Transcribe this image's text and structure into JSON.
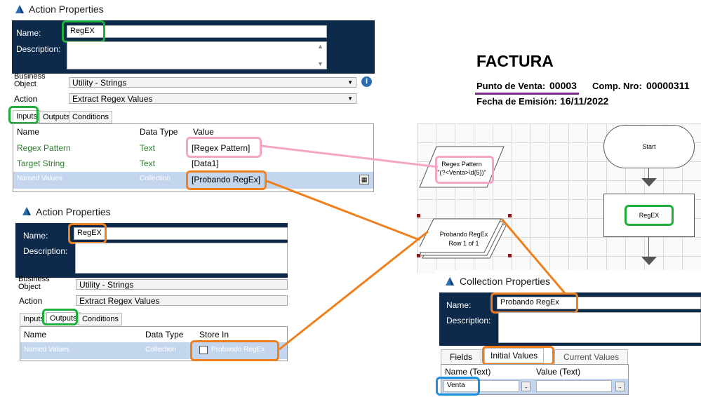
{
  "panel1": {
    "title": "Action Properties",
    "name_label": "Name:",
    "name_value": "RegEX",
    "description_label": "Description:",
    "business_object_label": "Business Object",
    "business_object_value": "Utility - Strings",
    "action_label": "Action",
    "action_value": "Extract Regex Values",
    "tabs": [
      "Inputs",
      "Outputs",
      "Conditions"
    ],
    "columns": [
      "Name",
      "Data Type",
      "Value"
    ],
    "rows": [
      {
        "name": "Regex Pattern",
        "type": "Text",
        "value": "[Regex Pattern]"
      },
      {
        "name": "Target String",
        "type": "Text",
        "value": "[Data1]"
      },
      {
        "name": "Named Values",
        "type": "Collection",
        "value": "[Probando RegEx]"
      }
    ]
  },
  "panel2": {
    "title": "Action Properties",
    "name_label": "Name:",
    "name_value": "RegEX",
    "description_label": "Description:",
    "business_object_label": "Business Object",
    "business_object_value": "Utility - Strings",
    "action_label": "Action",
    "action_value": "Extract Regex Values",
    "tabs": [
      "Inputs",
      "Outputs",
      "Conditions"
    ],
    "columns": [
      "Name",
      "Data Type",
      "Store In"
    ],
    "rows": [
      {
        "name": "Named Values",
        "type": "Collection",
        "value": "Probando RegEx"
      }
    ]
  },
  "invoice": {
    "heading": "FACTURA",
    "punto_label": "Punto de Venta:",
    "punto_value": "00003",
    "comp_label": "Comp. Nro:",
    "comp_value": "00000311",
    "fecha_label": "Fecha de Emisión:",
    "fecha_value": "16/11/2022"
  },
  "flow": {
    "start_label": "Start",
    "action_label": "RegEX",
    "data_item_line1": "Regex Pattern",
    "data_item_line2": "\"(?<Venta>\\d{5})\"",
    "collection_line1": "Probando RegEx",
    "collection_line2": "Row 1 of 1"
  },
  "collection": {
    "title": "Collection Properties",
    "name_label": "Name:",
    "name_value": "Probando RegEx",
    "description_label": "Description:",
    "tabs": [
      "Fields",
      "Initial Values",
      "Current Values"
    ],
    "columns": [
      "Name  (Text)",
      "Value  (Text)"
    ],
    "row_name": "Venta",
    "ellipsis": ".."
  },
  "colors": {
    "navy": "#0d2a4a",
    "green": "#1fae3a",
    "orange": "#f0801d",
    "pink": "#f4a6c6",
    "blue": "#1e90e0",
    "purple": "#7a2a8a"
  }
}
